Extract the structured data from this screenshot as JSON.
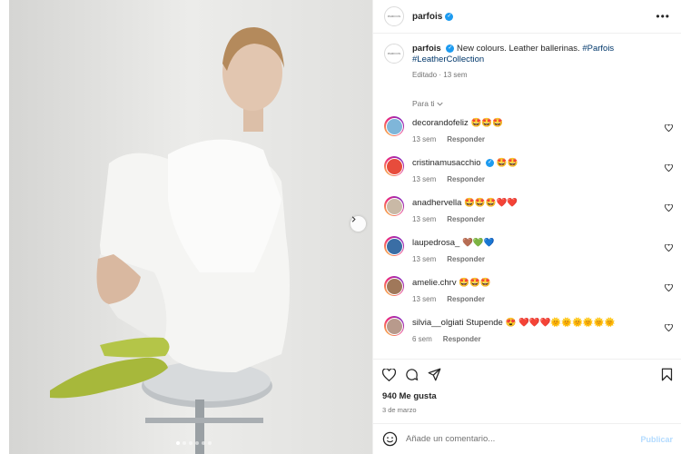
{
  "post": {
    "brand_avatar_text": "PARFOIS",
    "username": "parfois",
    "caption": {
      "text": "New colours. Leather ballerinas.",
      "hashtags": [
        "#Parfois",
        "#LeatherCollection"
      ],
      "edited": "Editado",
      "age": "13 sem"
    },
    "sort_label": "Para ti"
  },
  "comments": [
    {
      "user": "decorandofeliz",
      "text": "🤩🤩🤩",
      "age": "13 sem",
      "reply": "Responder",
      "verified": false,
      "avatar_color": "#7fb6d9"
    },
    {
      "user": "cristinamusacchio",
      "text": "🤩🤩",
      "age": "13 sem",
      "reply": "Responder",
      "verified": true,
      "avatar_color": "#e74c3c"
    },
    {
      "user": "anadhervella",
      "text": "🤩🤩🤩❤️❤️",
      "age": "13 sem",
      "reply": "Responder",
      "verified": false,
      "avatar_color": "#c9b9a6"
    },
    {
      "user": "laupedrosa_",
      "text": "🤎💚💙",
      "age": "13 sem",
      "reply": "Responder",
      "verified": false,
      "avatar_color": "#3a6ea5"
    },
    {
      "user": "amelie.chrv",
      "text": "🤩🤩🤩",
      "age": "13 sem",
      "reply": "Responder",
      "verified": false,
      "avatar_color": "#a0785a"
    },
    {
      "user": "silvia__olgiati",
      "text": "Stupende 😍 ❤️❤️❤️🌞🌞🌞🌞🌞🌞",
      "age": "6 sem",
      "reply": "Responder",
      "verified": false,
      "avatar_color": "#b89a8c"
    }
  ],
  "actions": {
    "likes": "940 Me gusta",
    "date": "3 de marzo"
  },
  "composer": {
    "placeholder": "Añade un comentario...",
    "publish": "Publicar"
  },
  "carousel": {
    "count": 6,
    "active_index": 0
  },
  "colors": {
    "verified": "#1d9bf0",
    "hashtag": "#00376b",
    "muted": "#737373"
  }
}
